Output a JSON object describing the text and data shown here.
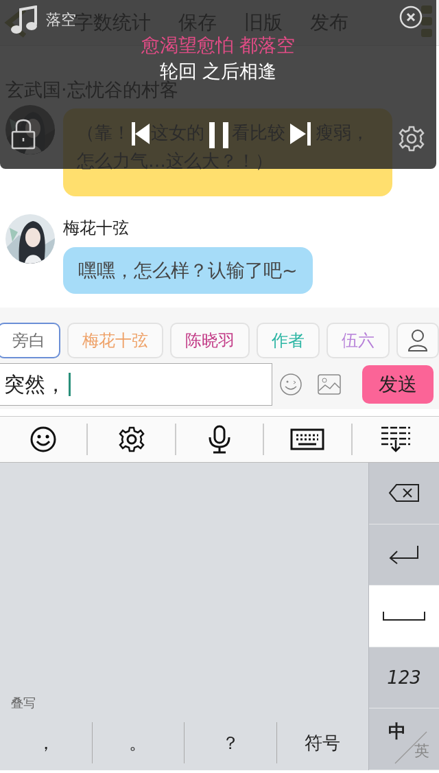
{
  "header": {
    "actions": [
      "字数统计",
      "保存",
      "旧版",
      "发布"
    ]
  },
  "story_title": "玄武国·忘忧谷的村客",
  "messages": [
    {
      "color": "#ffdf6e",
      "lines": [
        [
          "（靠！",
          "这女的",
          "看比较",
          "瘦弱，"
        ],
        [
          "怎么力气…这么大？！）"
        ]
      ]
    },
    {
      "name": "梅花十弦",
      "color": "#a6dcf8",
      "lines": [
        [
          "嘿嘿，怎么样？认输了吧~"
        ]
      ]
    }
  ],
  "player": {
    "song": "落空",
    "playing": true,
    "lyrics": [
      {
        "text": "愈渴望愈怕 都落空",
        "current": true
      },
      {
        "text": "轮回 之后相逢",
        "current": false
      }
    ]
  },
  "roles": [
    {
      "label": "旁白",
      "selected": true,
      "color": "#707070"
    },
    {
      "label": "梅花十弦",
      "selected": false,
      "color": "#eea066"
    },
    {
      "label": "陈晓羽",
      "selected": false,
      "color": "#c23a86"
    },
    {
      "label": "作者",
      "selected": false,
      "color": "#2bb5a3"
    },
    {
      "label": "伍六",
      "selected": false,
      "color": "#b67fd8"
    }
  ],
  "composer": {
    "value": "突然，",
    "send": "发送"
  },
  "keyboard": {
    "mode_label": "叠写",
    "keys": [
      "，",
      "。",
      "？",
      "符号"
    ],
    "side_keys": [
      {
        "kind": "backspace"
      },
      {
        "kind": "enter"
      },
      {
        "kind": "space"
      },
      {
        "kind": "text",
        "label": "123"
      },
      {
        "kind": "lang",
        "primary": "中",
        "secondary": "英"
      }
    ]
  }
}
